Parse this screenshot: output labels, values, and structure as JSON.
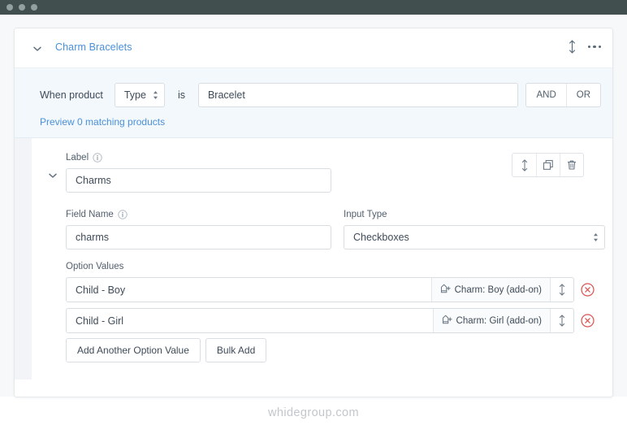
{
  "window": {
    "dots": [
      "close-dot",
      "minimize-dot",
      "maximize-dot"
    ]
  },
  "card": {
    "header": {
      "title": "Charm Bracelets",
      "collapse_icon": "chevron-down-icon",
      "reorder_icon": "drag-vertical-icon",
      "menu_icon": "ellipsis-icon"
    },
    "condition": {
      "prefix_label": "When product",
      "attribute_select": "Type",
      "operator_label": "is",
      "value": "Bracelet",
      "value_placeholder": "",
      "logic_and": "AND",
      "logic_or": "OR",
      "preview_link": "Preview 0 matching products"
    },
    "field": {
      "collapse_icon": "chevron-down-icon",
      "label_field": {
        "label": "Label",
        "info_icon": "info-circle-icon",
        "value": "Charms"
      },
      "row_actions": [
        {
          "name": "reorder",
          "icon": "drag-vertical-icon"
        },
        {
          "name": "duplicate",
          "icon": "copy-icon"
        },
        {
          "name": "delete",
          "icon": "trash-icon"
        }
      ],
      "field_name": {
        "label": "Field Name",
        "info_icon": "info-circle-icon",
        "value": "charms"
      },
      "input_type": {
        "label": "Input Type",
        "value": "Checkboxes",
        "caret_icon": "updown-caret-icon"
      },
      "option_values": {
        "title": "Option Values",
        "rows": [
          {
            "value": "Child - Boy",
            "tag_icon": "tag-plus-icon",
            "tag_text": "Charm: Boy (add-on)",
            "grip_icon": "drag-vertical-icon",
            "delete_icon": "circle-x-icon"
          },
          {
            "value": "Child - Girl",
            "tag_icon": "tag-plus-icon",
            "tag_text": "Charm: Girl (add-on)",
            "grip_icon": "drag-vertical-icon",
            "delete_icon": "circle-x-icon"
          }
        ]
      },
      "buttons": {
        "add_option": "Add Another Option Value",
        "bulk_add": "Bulk Add"
      }
    }
  },
  "watermark": "whidegroup.com",
  "colors": {
    "titlebar": "#41504e",
    "link": "#4a90d9",
    "condition_bg": "#f3f8fd",
    "border": "#d9dee3",
    "danger": "#d9534f",
    "text": "#3f4b58"
  }
}
